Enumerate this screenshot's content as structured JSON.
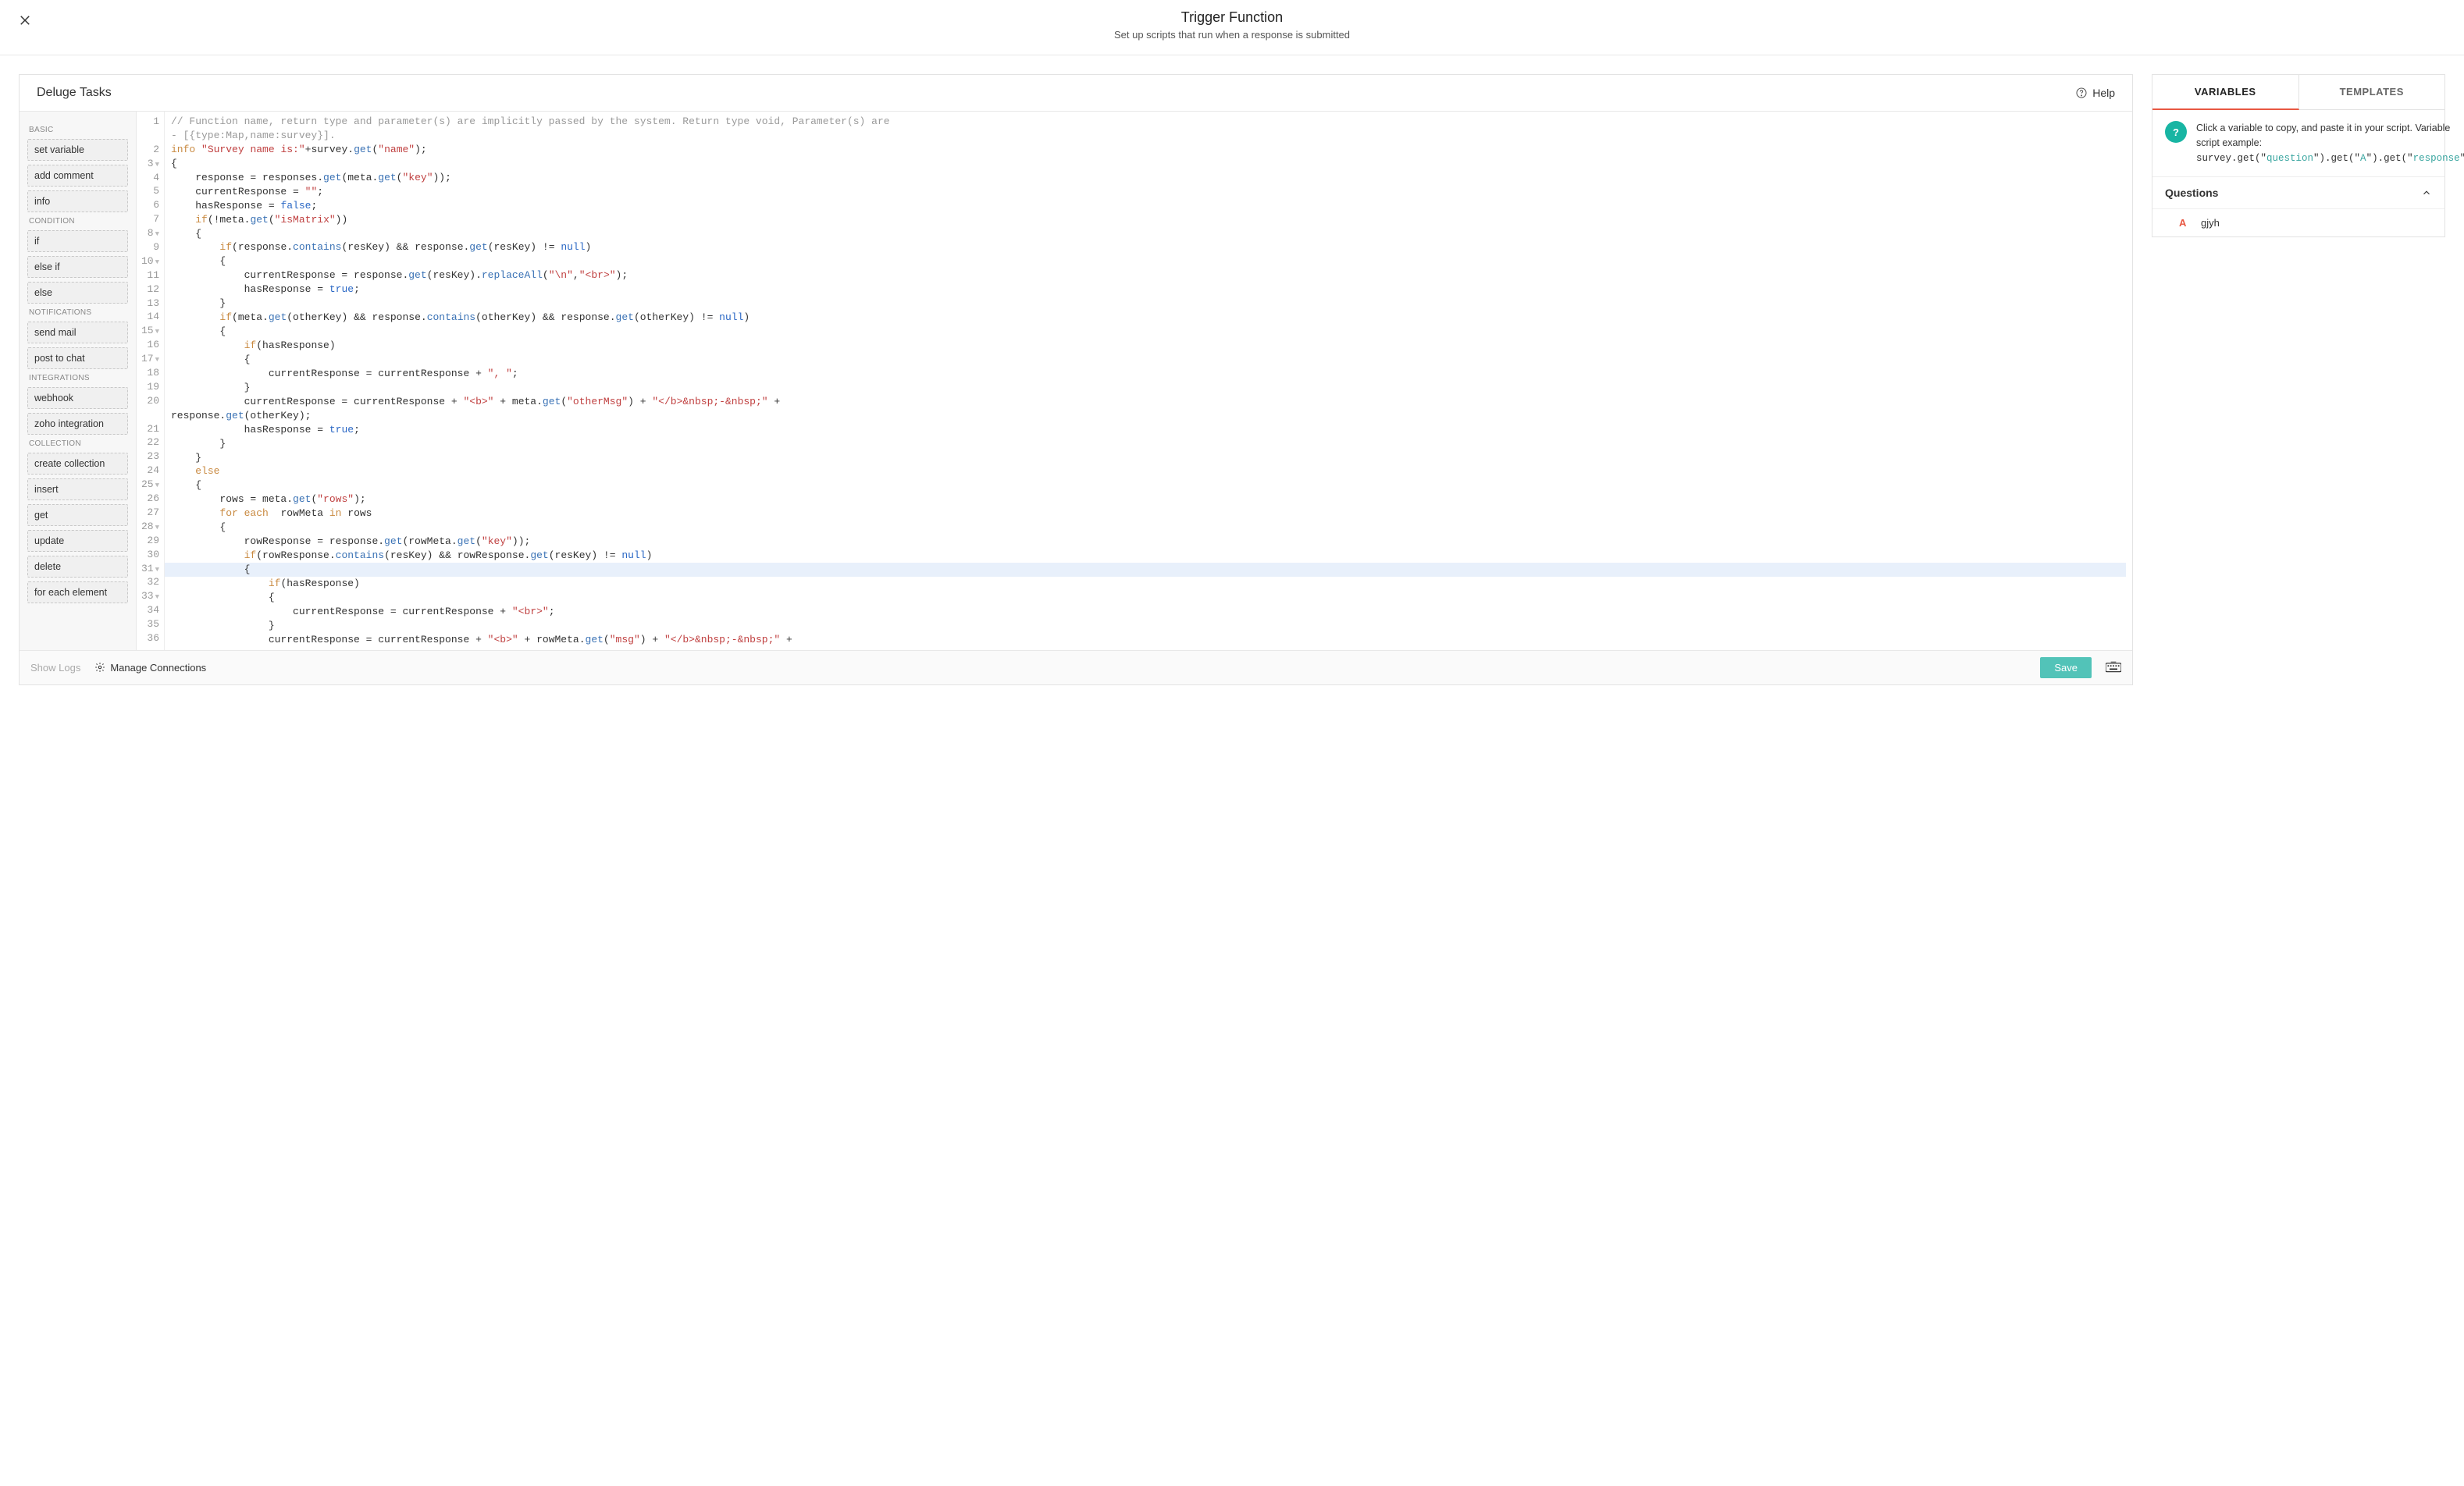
{
  "header": {
    "title": "Trigger Function",
    "subtitle": "Set up scripts that run when a response is submitted"
  },
  "editor": {
    "title": "Deluge Tasks",
    "help_label": "Help"
  },
  "tasks": {
    "groups": [
      {
        "title": "BASIC",
        "items": [
          "set variable",
          "add comment",
          "info"
        ]
      },
      {
        "title": "CONDITION",
        "items": [
          "if",
          "else if",
          "else"
        ]
      },
      {
        "title": "NOTIFICATIONS",
        "items": [
          "send mail",
          "post to chat"
        ]
      },
      {
        "title": "INTEGRATIONS",
        "items": [
          "webhook",
          "zoho integration"
        ]
      },
      {
        "title": "COLLECTION",
        "items": [
          "create collection",
          "insert",
          "get",
          "update",
          "delete",
          "for each element"
        ]
      }
    ]
  },
  "code": {
    "lines": [
      {
        "n": 1,
        "fold": false,
        "html": "<span class='tk-comment'>// Function name, return type and parameter(s) are implicitly passed by the system. Return type void, Parameter(s) are</span>"
      },
      {
        "n": null,
        "fold": false,
        "html": "<span class='tk-comment'>- [{type:Map,name:survey}].</span>"
      },
      {
        "n": 2,
        "fold": false,
        "html": "<span class='tk-keyword'>info</span> <span class='tk-str'>\"Survey name is:\"</span>+survey.<span class='tk-fn'>get</span>(<span class='tk-str'>\"name\"</span>);"
      },
      {
        "n": 3,
        "fold": true,
        "html": "{"
      },
      {
        "n": 4,
        "fold": false,
        "html": "    response = responses.<span class='tk-fn'>get</span>(meta.<span class='tk-fn'>get</span>(<span class='tk-str'>\"key\"</span>));"
      },
      {
        "n": 5,
        "fold": false,
        "html": "    currentResponse = <span class='tk-str'>\"\"</span>;"
      },
      {
        "n": 6,
        "fold": false,
        "html": "    hasResponse = <span class='tk-bool'>false</span>;"
      },
      {
        "n": 7,
        "fold": false,
        "html": "    <span class='tk-keyword'>if</span>(!meta.<span class='tk-fn'>get</span>(<span class='tk-str'>\"isMatrix\"</span>))"
      },
      {
        "n": 8,
        "fold": true,
        "html": "    {"
      },
      {
        "n": 9,
        "fold": false,
        "html": "        <span class='tk-keyword'>if</span>(response.<span class='tk-fn'>contains</span>(resKey) && response.<span class='tk-fn'>get</span>(resKey) != <span class='tk-null'>null</span>)"
      },
      {
        "n": 10,
        "fold": true,
        "html": "        {"
      },
      {
        "n": 11,
        "fold": false,
        "html": "            currentResponse = response.<span class='tk-fn'>get</span>(resKey).<span class='tk-fn'>replaceAll</span>(<span class='tk-str'>\"\\n\"</span>,<span class='tk-str'>\"&lt;br&gt;\"</span>);"
      },
      {
        "n": 12,
        "fold": false,
        "html": "            hasResponse = <span class='tk-bool'>true</span>;"
      },
      {
        "n": 13,
        "fold": false,
        "html": "        }"
      },
      {
        "n": 14,
        "fold": false,
        "html": "        <span class='tk-keyword'>if</span>(meta.<span class='tk-fn'>get</span>(otherKey) && response.<span class='tk-fn'>contains</span>(otherKey) && response.<span class='tk-fn'>get</span>(otherKey) != <span class='tk-null'>null</span>)"
      },
      {
        "n": 15,
        "fold": true,
        "html": "        {"
      },
      {
        "n": 16,
        "fold": false,
        "html": "            <span class='tk-keyword'>if</span>(hasResponse)"
      },
      {
        "n": 17,
        "fold": true,
        "html": "            {"
      },
      {
        "n": 18,
        "fold": false,
        "html": "                currentResponse = currentResponse + <span class='tk-str'>\", \"</span>;"
      },
      {
        "n": 19,
        "fold": false,
        "html": "            }"
      },
      {
        "n": 20,
        "fold": false,
        "html": "            currentResponse = currentResponse + <span class='tk-str'>\"&lt;b&gt;\"</span> + meta.<span class='tk-fn'>get</span>(<span class='tk-str'>\"otherMsg\"</span>) + <span class='tk-str'>\"&lt;/b&gt;&amp;nbsp;-&amp;nbsp;\"</span> +"
      },
      {
        "n": null,
        "fold": false,
        "html": "response.<span class='tk-fn'>get</span>(otherKey);"
      },
      {
        "n": 21,
        "fold": false,
        "html": "            hasResponse = <span class='tk-bool'>true</span>;"
      },
      {
        "n": 22,
        "fold": false,
        "html": "        }"
      },
      {
        "n": 23,
        "fold": false,
        "html": "    }"
      },
      {
        "n": 24,
        "fold": false,
        "html": "    <span class='tk-keyword'>else</span>"
      },
      {
        "n": 25,
        "fold": true,
        "html": "    {"
      },
      {
        "n": 26,
        "fold": false,
        "html": "        rows = meta.<span class='tk-fn'>get</span>(<span class='tk-str'>\"rows\"</span>);"
      },
      {
        "n": 27,
        "fold": false,
        "html": "        <span class='tk-keyword'>for each</span>  rowMeta <span class='tk-keyword'>in</span> rows"
      },
      {
        "n": 28,
        "fold": true,
        "html": "        {"
      },
      {
        "n": 29,
        "fold": false,
        "html": "            rowResponse = response.<span class='tk-fn'>get</span>(rowMeta.<span class='tk-fn'>get</span>(<span class='tk-str'>\"key\"</span>));"
      },
      {
        "n": 30,
        "fold": false,
        "html": "            <span class='tk-keyword'>if</span>(rowResponse.<span class='tk-fn'>contains</span>(resKey) && rowResponse.<span class='tk-fn'>get</span>(resKey) != <span class='tk-null'>null</span>)"
      },
      {
        "n": 31,
        "fold": true,
        "hl": true,
        "html": "            {"
      },
      {
        "n": 32,
        "fold": false,
        "html": "                <span class='tk-keyword'>if</span>(hasResponse)"
      },
      {
        "n": 33,
        "fold": true,
        "html": "                {"
      },
      {
        "n": 34,
        "fold": false,
        "html": "                    currentResponse = currentResponse + <span class='tk-str'>\"&lt;br&gt;\"</span>;"
      },
      {
        "n": 35,
        "fold": false,
        "html": "                }"
      },
      {
        "n": 36,
        "fold": false,
        "html": "                currentResponse = currentResponse + <span class='tk-str'>\"&lt;b&gt;\"</span> + rowMeta.<span class='tk-fn'>get</span>(<span class='tk-str'>\"msg\"</span>) + <span class='tk-str'>\"&lt;/b&gt;&amp;nbsp;-&amp;nbsp;\"</span> +"
      }
    ]
  },
  "footer": {
    "show_logs": "Show Logs",
    "manage_connections": "Manage Connections",
    "save_label": "Save"
  },
  "right": {
    "tabs": {
      "variables": "VARIABLES",
      "templates": "TEMPLATES"
    },
    "info_text_1": "Click a variable to copy, and paste it in your script. Variable script example:",
    "info_code_prefix": "survey.get(\"",
    "info_code_q": "question",
    "info_code_mid1": "\").get(\"",
    "info_code_a": "A",
    "info_code_mid2": "\").get(\"",
    "info_code_r": "response",
    "info_code_suffix": "\")",
    "section_title": "Questions",
    "questions": [
      {
        "badge": "A",
        "label": "gjyh"
      }
    ]
  }
}
